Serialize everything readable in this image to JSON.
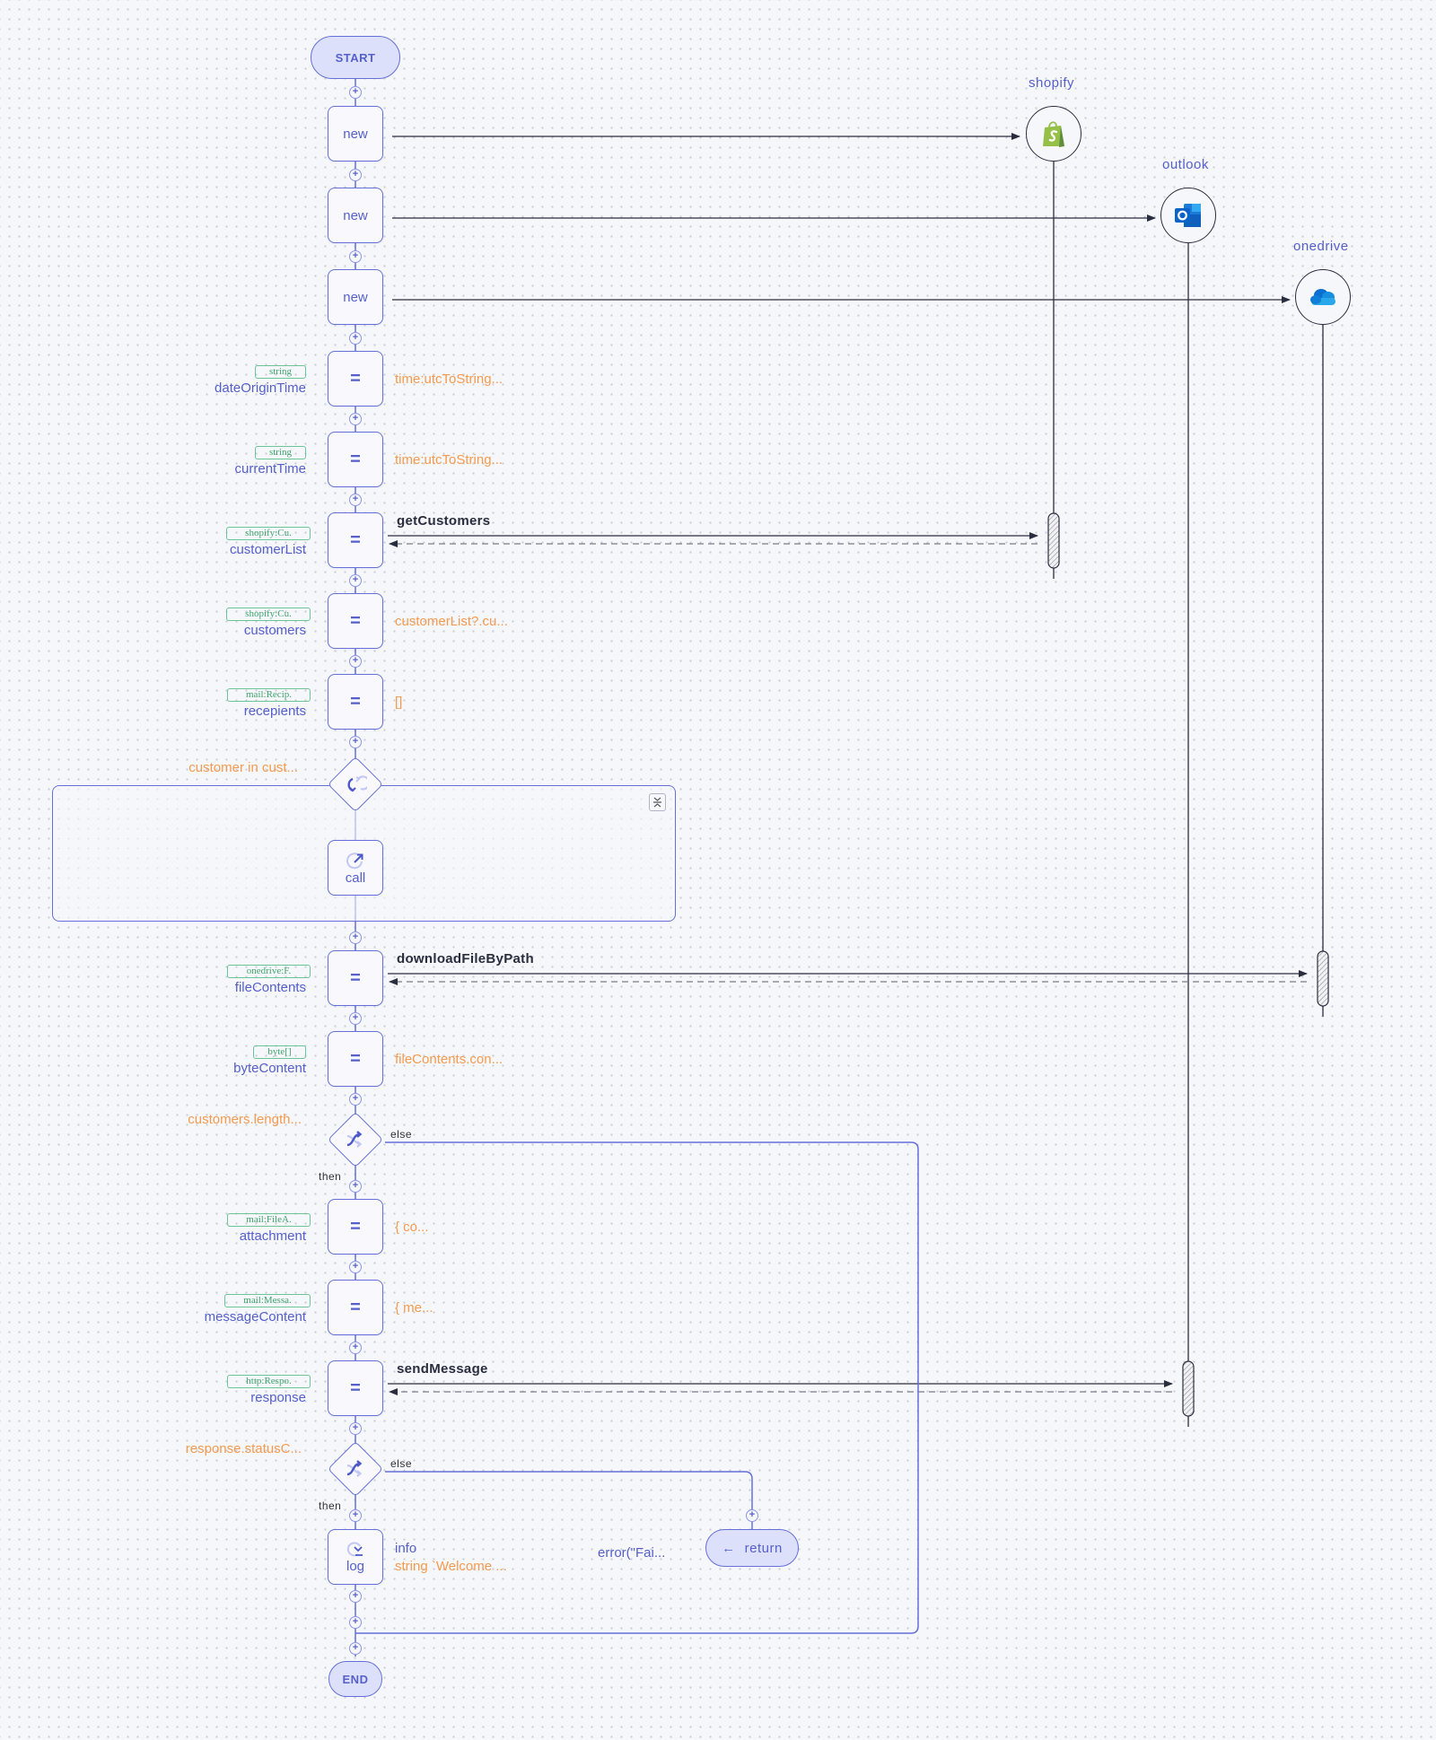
{
  "start": {
    "label": "START"
  },
  "end": {
    "label": "END"
  },
  "endpoints": [
    {
      "id": "shopify",
      "label": "shopify",
      "icon": "shopify-icon",
      "color": "#95bf47"
    },
    {
      "id": "outlook",
      "label": "outlook",
      "icon": "outlook-icon",
      "color": "#0a64c8"
    },
    {
      "id": "onedrive",
      "label": "onedrive",
      "icon": "onedrive-icon",
      "color": "#1a8ae6"
    }
  ],
  "new_nodes": [
    {
      "label": "new",
      "target": "shopify"
    },
    {
      "label": "new",
      "target": "outlook"
    },
    {
      "label": "new",
      "target": "onedrive"
    }
  ],
  "assignments": [
    {
      "id": "dateOriginTime",
      "var": "dateOriginTime",
      "type": "string",
      "symbol": "=",
      "expr": "time:utcToString..."
    },
    {
      "id": "currentTime",
      "var": "currentTime",
      "type": "string",
      "symbol": "=",
      "expr": "time:utcToString..."
    },
    {
      "id": "customerList",
      "var": "customerList",
      "type": "shopify:Cu.",
      "symbol": "=",
      "action": "getCustomers",
      "target": "shopify"
    },
    {
      "id": "customers",
      "var": "customers",
      "type": "shopify:Cu.",
      "symbol": "=",
      "expr": "customerList?.cu..."
    },
    {
      "id": "recepients",
      "var": "recepients",
      "type": "mail:Recip.",
      "symbol": "=",
      "expr": "[]"
    },
    {
      "id": "fileContents",
      "var": "fileContents",
      "type": "onedrive:F.",
      "symbol": "=",
      "action": "downloadFileByPath",
      "target": "onedrive"
    },
    {
      "id": "byteContent",
      "var": "byteContent",
      "type": "byte[]",
      "symbol": "=",
      "expr": "fileContents.con..."
    },
    {
      "id": "attachment",
      "var": "attachment",
      "type": "mail:FileA.",
      "symbol": "=",
      "expr": "{ co..."
    },
    {
      "id": "messageContent",
      "var": "messageContent",
      "type": "mail:Messa.",
      "symbol": "=",
      "expr": "{ me..."
    },
    {
      "id": "response",
      "var": "response",
      "type": "http:Respo.",
      "symbol": "=",
      "action": "sendMessage",
      "target": "outlook"
    }
  ],
  "loop": {
    "condition": "customer in cust...",
    "call_label": "call",
    "collapse_icon": "collapse-icon"
  },
  "if1": {
    "condition": "customers.length...",
    "then_label": "then",
    "else_label": "else"
  },
  "if2": {
    "condition": "response.statusC...",
    "then_label": "then",
    "else_label": "else"
  },
  "log": {
    "label": "log",
    "level": "info",
    "message": "string `Welcome ..."
  },
  "return_node": {
    "label": "return",
    "expr": "error(\"Fai..."
  }
}
